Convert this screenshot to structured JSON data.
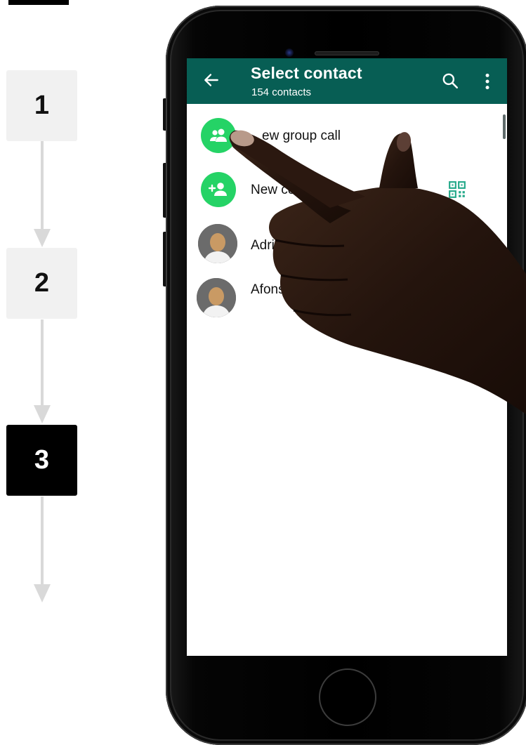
{
  "steps": [
    {
      "number": "1",
      "state": "inactive"
    },
    {
      "number": "2",
      "state": "inactive"
    },
    {
      "number": "3",
      "state": "active"
    }
  ],
  "colors": {
    "appbar": "#075e54",
    "accent_green": "#25d366",
    "step_active": "#000000",
    "step_inactive": "#f1f1f1",
    "connector": "#d9d9d9"
  },
  "appbar": {
    "back_icon": "arrow-left-icon",
    "title": "Select contact",
    "subtitle": "154 contacts",
    "search_icon": "search-icon",
    "more_icon": "more-vertical-icon"
  },
  "list": {
    "new_group_call": {
      "label": "New group call",
      "visible_label": "ew group call",
      "icon": "group-icon"
    },
    "new_contact": {
      "label": "New co",
      "icon": "add-person-icon",
      "trailing_icon": "qr-code-icon"
    },
    "contacts": [
      {
        "name": "Adri"
      },
      {
        "name": "Afons"
      }
    ]
  }
}
